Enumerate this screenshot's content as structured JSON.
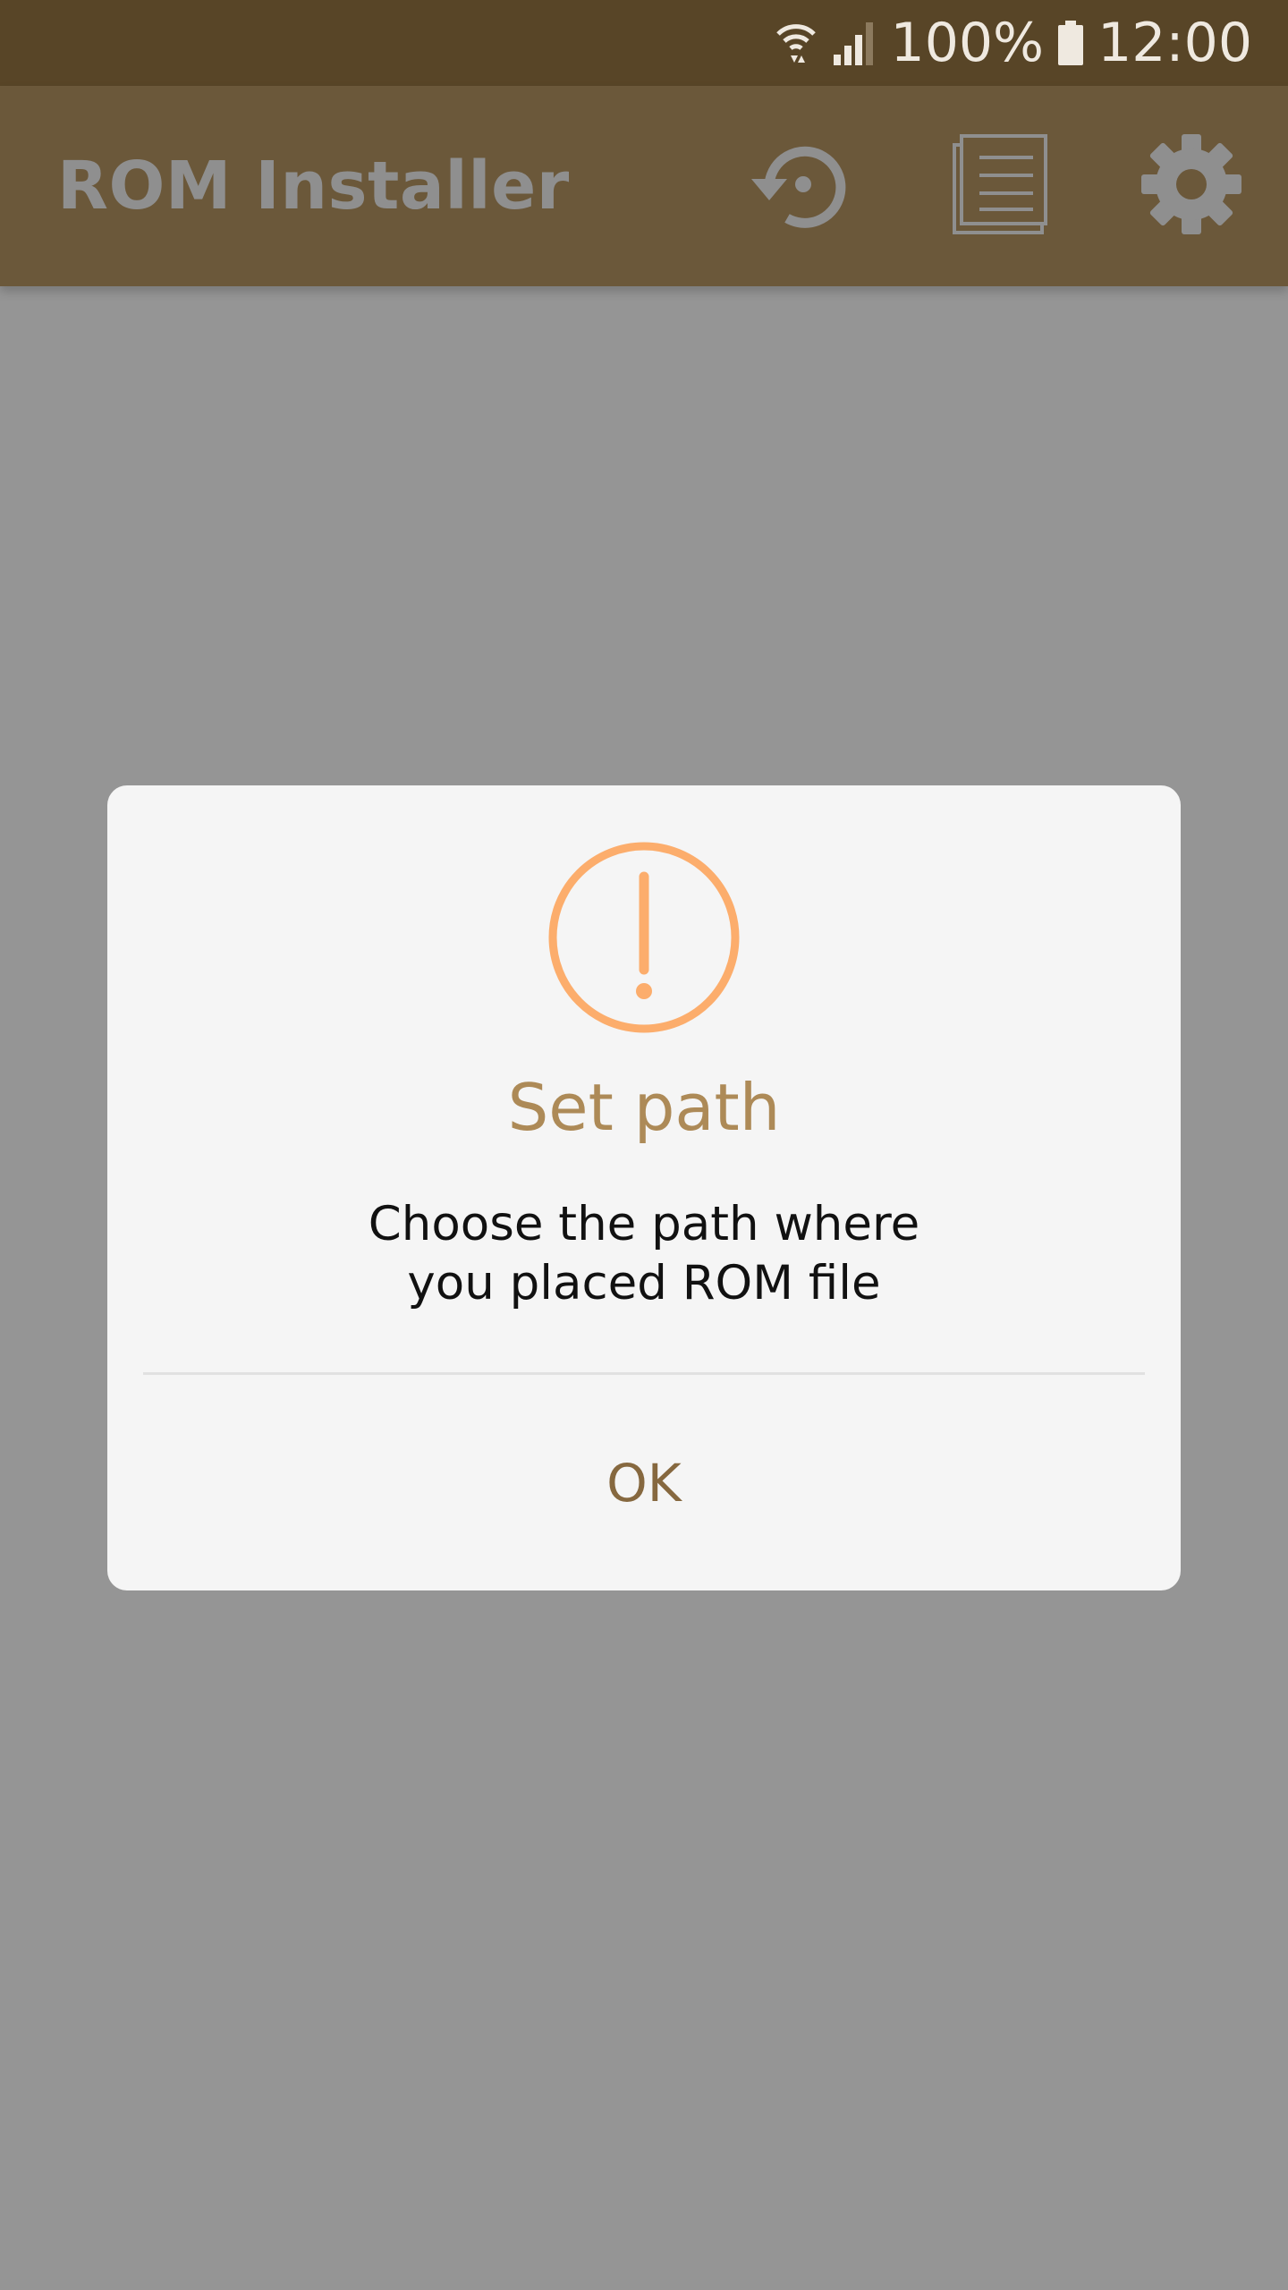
{
  "status_bar": {
    "battery_percent": "100%",
    "time": "12:00",
    "icons": [
      "wifi-icon",
      "signal-icon",
      "battery-icon"
    ]
  },
  "app_bar": {
    "title": "ROM Installer",
    "actions": [
      {
        "name": "history",
        "icon": "history-icon"
      },
      {
        "name": "log",
        "icon": "log-icon"
      },
      {
        "name": "settings",
        "icon": "gear-icon"
      }
    ]
  },
  "dialog": {
    "icon": "warning-circle-icon",
    "title": "Set path",
    "message_line1": "Choose the path where",
    "message_line2": "you placed ROM file",
    "ok_label": "OK"
  },
  "colors": {
    "status_bar_bg": "#584527",
    "app_bar_bg": "#6b583a",
    "scrim": "#959595",
    "dialog_bg": "#f5f5f5",
    "dialog_title": "#ad8a57",
    "warning_icon": "#fcad6c",
    "ok_text": "#86683f"
  }
}
